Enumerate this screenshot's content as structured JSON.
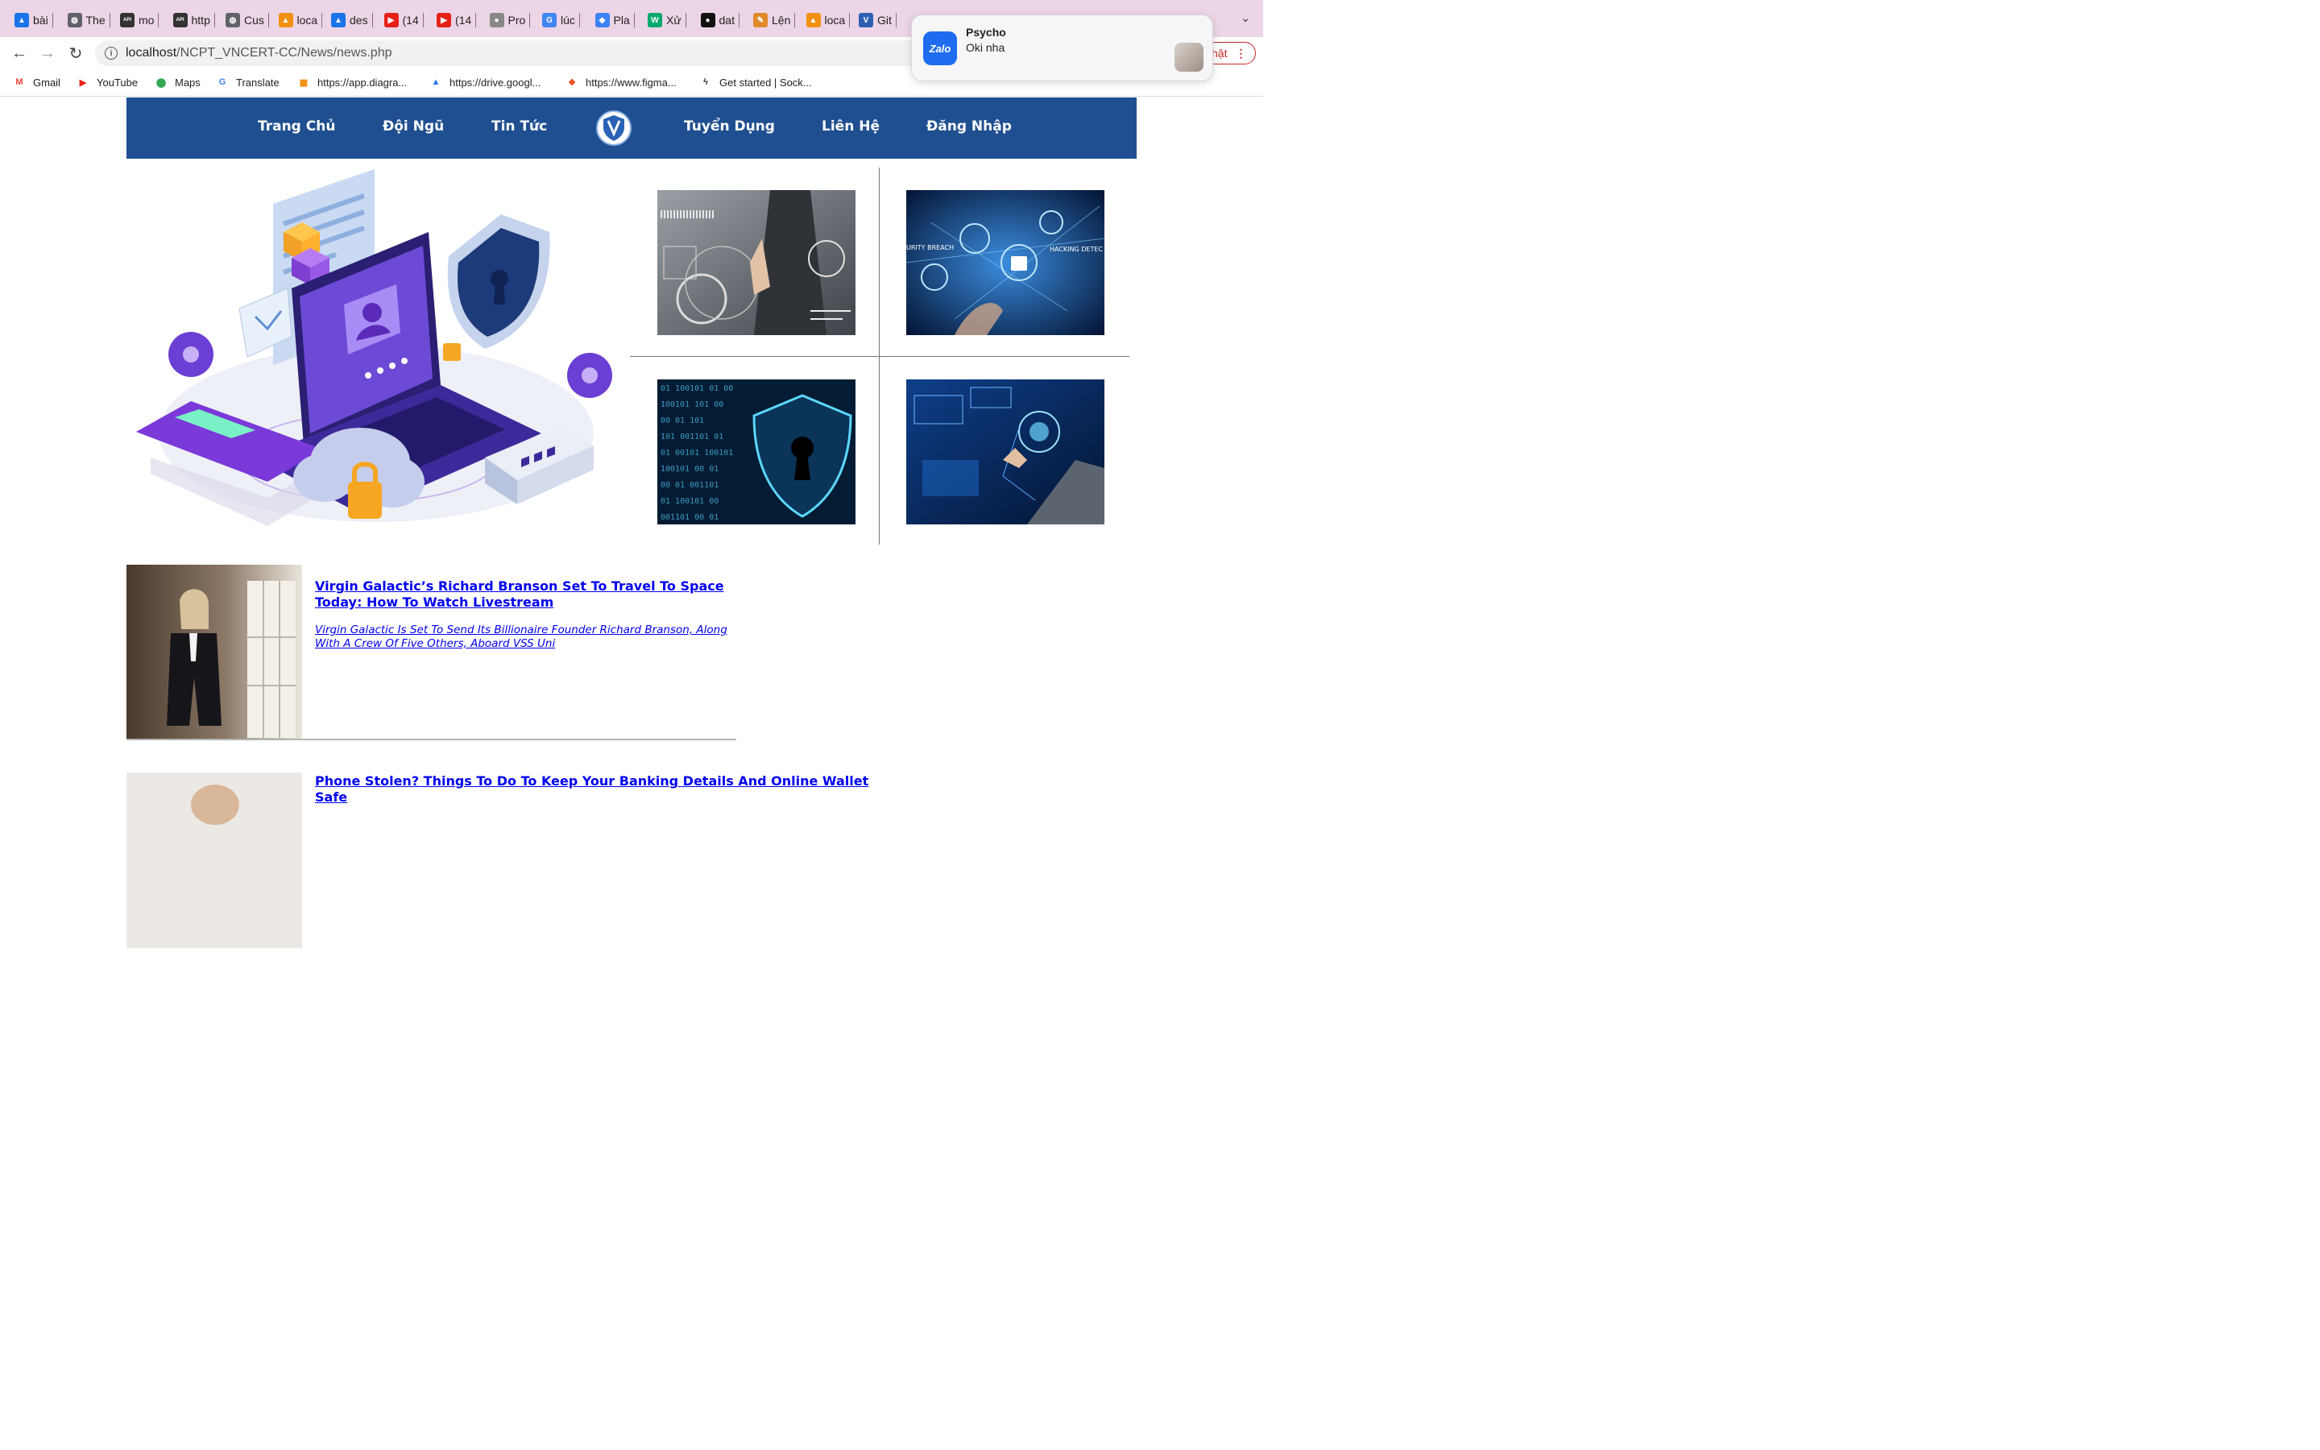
{
  "browser": {
    "tabs": [
      {
        "label": "bài",
        "icon": "google-drive-icon",
        "color": "#1a73e8",
        "glyph": "▲"
      },
      {
        "label": "The",
        "icon": "globe-icon",
        "color": "#5f6368",
        "glyph": "◍"
      },
      {
        "label": "mo",
        "icon": "mockapi-icon",
        "color": "#333333",
        "glyph": "API"
      },
      {
        "label": "http",
        "icon": "mockapi-icon",
        "color": "#333333",
        "glyph": "API"
      },
      {
        "label": "Cus",
        "icon": "globe-icon",
        "color": "#5f6368",
        "glyph": "◍"
      },
      {
        "label": "loca",
        "icon": "phpmyadmin-icon",
        "color": "#f29111",
        "glyph": "▲"
      },
      {
        "label": "des",
        "icon": "google-drive-icon",
        "color": "#1a73e8",
        "glyph": "▲"
      },
      {
        "label": "(14",
        "icon": "youtube-icon",
        "color": "#e62117",
        "glyph": "▶"
      },
      {
        "label": "(14",
        "icon": "youtube-icon",
        "color": "#e62117",
        "glyph": "▶"
      },
      {
        "label": "Pro",
        "icon": "apple-icon",
        "color": "#888888",
        "glyph": "●"
      },
      {
        "label": "lúc",
        "icon": "google-icon",
        "color": "#4285f4",
        "glyph": "G"
      },
      {
        "label": "Pla",
        "icon": "app-icon",
        "color": "#3b82f6",
        "glyph": "◆"
      },
      {
        "label": "Xử",
        "icon": "w3schools-icon",
        "color": "#04aa6d",
        "glyph": "W"
      },
      {
        "label": "dat",
        "icon": "github-icon",
        "color": "#111111",
        "glyph": "●"
      },
      {
        "label": "Lện",
        "icon": "link-icon",
        "color": "#e08a2c",
        "glyph": "✎"
      },
      {
        "label": "loca",
        "icon": "phpmyadmin-icon",
        "color": "#f29111",
        "glyph": "▲"
      },
      {
        "label": "Git",
        "icon": "vuejs-icon",
        "color": "#2f5fb3",
        "glyph": "V"
      }
    ],
    "address": {
      "host": "localhost",
      "path": "/NCPT_VNCERT-CC/News/news.php"
    },
    "update_button": "hật",
    "bookmarks": [
      {
        "label": "Gmail",
        "icon": "gmail-icon",
        "color": "#ea4335",
        "glyph": "M"
      },
      {
        "label": "YouTube",
        "icon": "youtube-icon",
        "color": "#e62117",
        "glyph": "▶"
      },
      {
        "label": "Maps",
        "icon": "maps-pin-icon",
        "color": "#34a853",
        "glyph": "⬤"
      },
      {
        "label": "Translate",
        "icon": "translate-icon",
        "color": "#4285f4",
        "glyph": "G"
      },
      {
        "label": "https://app.diagra...",
        "icon": "diagrams-icon",
        "color": "#f08705",
        "glyph": "▦"
      },
      {
        "label": "https://drive.googl...",
        "icon": "google-drive-icon",
        "color": "#1a73e8",
        "glyph": "▲"
      },
      {
        "label": "https://www.figma...",
        "icon": "figma-icon",
        "color": "#f24e1e",
        "glyph": "❖"
      },
      {
        "label": "Get started | Sock...",
        "icon": "socket-icon",
        "color": "#333333",
        "glyph": "ϟ"
      }
    ]
  },
  "notification": {
    "app_glyph": "Zalo",
    "title": "Psycho",
    "message": "Oki nha"
  },
  "site": {
    "menu": [
      "Trang Chủ",
      "Đội Ngũ",
      "Tin Tức",
      "Tuyển Dụng",
      "Liên Hệ",
      "Đăng Nhập"
    ],
    "logo_text": "VNCERT",
    "thumb_labels": {
      "breach": "URITY BREACH",
      "hacking": "HACKING DETEC"
    },
    "articles": [
      {
        "title": "Virgin Galactic’s Richard Branson Set To Travel To Space Today: How To Watch Livestream",
        "description": "Virgin Galactic Is Set To Send Its Billionaire Founder Richard Branson, Along With A Crew Of Five Others, Aboard VSS Uni"
      },
      {
        "title": "Phone Stolen? Things To Do To Keep Your Banking Details And Online Wallet Safe",
        "description": ""
      }
    ]
  }
}
